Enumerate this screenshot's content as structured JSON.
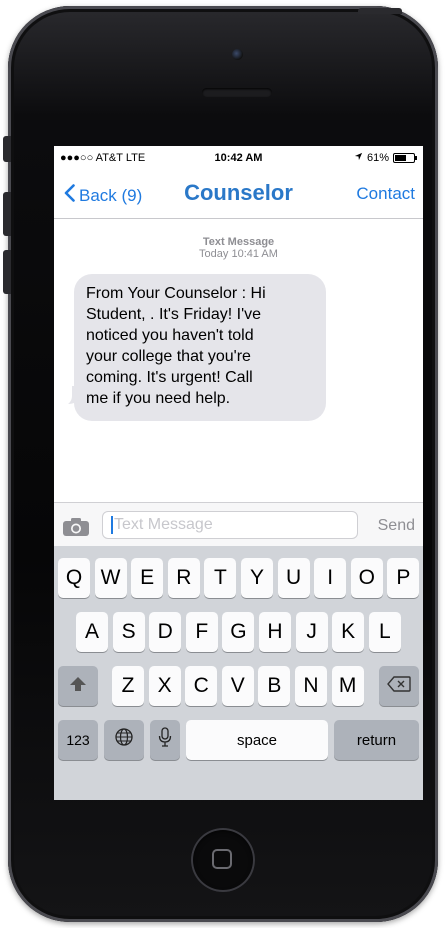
{
  "status": {
    "carrier": "●●●○○ AT&T  LTE",
    "time": "10:42 AM",
    "battery": "61%",
    "battery_level": 0.61
  },
  "nav": {
    "back_label": "Back (9)",
    "title": "Counselor",
    "contact_label": "Contact"
  },
  "thread": {
    "meta_top": "Text Message",
    "meta_time": "Today 10:41 AM",
    "message": "From Your Counselor  : Hi\n Student, . It's Friday! I've\nnoticed you haven't told\nyour college that you're\ncoming. It's urgent! Call\nme if you need help."
  },
  "compose": {
    "placeholder": "Text Message",
    "send_label": "Send"
  },
  "keyboard": {
    "row1": [
      "Q",
      "W",
      "E",
      "R",
      "T",
      "Y",
      "U",
      "I",
      "O",
      "P"
    ],
    "row2": [
      "A",
      "S",
      "D",
      "F",
      "G",
      "H",
      "J",
      "K",
      "L"
    ],
    "row3": [
      "Z",
      "X",
      "C",
      "V",
      "B",
      "N",
      "M"
    ],
    "numbers_label": "123",
    "space_label": "space",
    "return_label": "return"
  },
  "icons": {
    "back": "chevron-left-icon",
    "camera": "camera-icon",
    "shift": "shift-icon",
    "delete": "delete-icon",
    "globe": "globe-icon",
    "mic": "microphone-icon",
    "location": "location-arrow-icon",
    "home": "home-button"
  }
}
